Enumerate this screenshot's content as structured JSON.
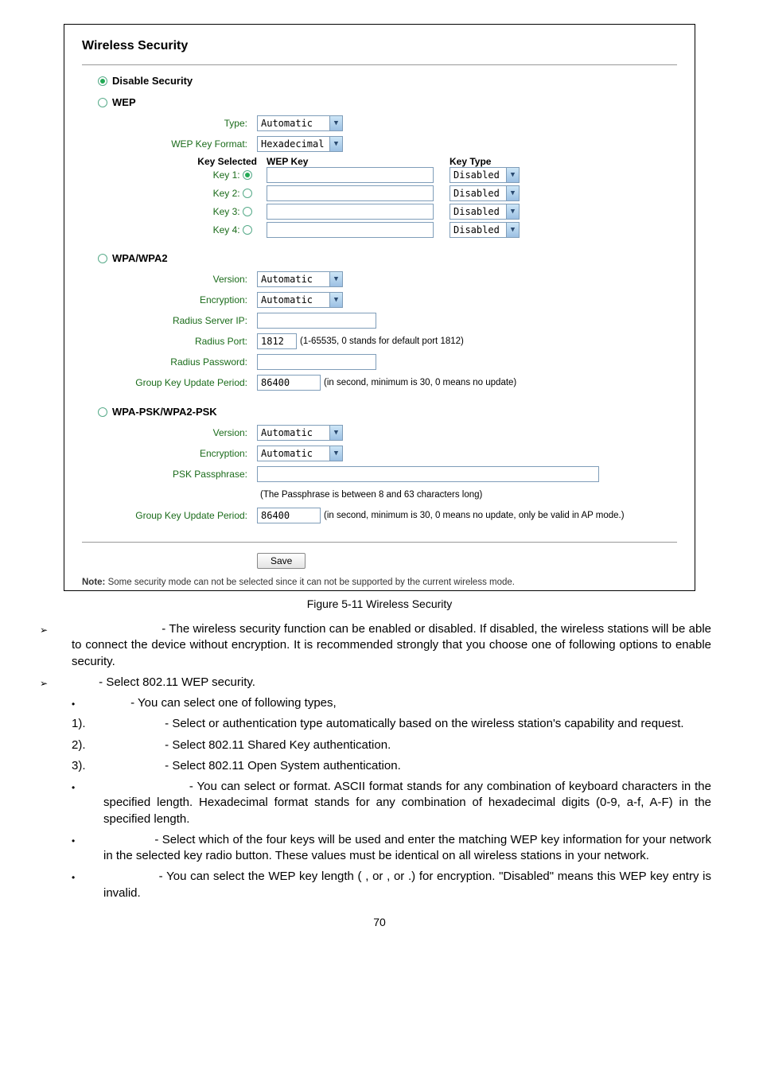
{
  "figure": {
    "title": "Wireless Security",
    "disable_security_label": "Disable Security",
    "wep": {
      "heading": "WEP",
      "type_label": "Type:",
      "type_value": "Automatic",
      "format_label": "WEP Key Format:",
      "format_value": "Hexadecimal",
      "key_selected_header": "Key Selected",
      "wep_key_header": "WEP Key",
      "key_type_header": "Key Type",
      "rows": [
        {
          "label": "Key 1:",
          "selected": true,
          "type": "Disabled"
        },
        {
          "label": "Key 2:",
          "selected": false,
          "type": "Disabled"
        },
        {
          "label": "Key 3:",
          "selected": false,
          "type": "Disabled"
        },
        {
          "label": "Key 4:",
          "selected": false,
          "type": "Disabled"
        }
      ]
    },
    "wpa": {
      "heading": "WPA/WPA2",
      "version_label": "Version:",
      "version_value": "Automatic",
      "encryption_label": "Encryption:",
      "encryption_value": "Automatic",
      "radius_ip_label": "Radius Server IP:",
      "radius_port_label": "Radius Port:",
      "radius_port_value": "1812",
      "radius_port_hint": "(1-65535, 0 stands for default port 1812)",
      "radius_pw_label": "Radius Password:",
      "gkup_label": "Group Key Update Period:",
      "gkup_value": "86400",
      "gkup_hint": "(in second, minimum is 30, 0 means no update)"
    },
    "psk": {
      "heading": "WPA-PSK/WPA2-PSK",
      "version_label": "Version:",
      "version_value": "Automatic",
      "encryption_label": "Encryption:",
      "encryption_value": "Automatic",
      "passphrase_label": "PSK Passphrase:",
      "passphrase_hint": "(The Passphrase is between 8 and 63 characters long)",
      "gkup_label": "Group Key Update Period:",
      "gkup_value": "86400",
      "gkup_hint": "(in second, minimum is 30, 0 means no update, only be valid in AP mode.)"
    },
    "save_label": "Save",
    "note_prefix": "Note:",
    "note_text": "  Some security mode can not be selected since it can not be supported by the current wireless mode."
  },
  "caption": "Figure 5-11 Wireless Security",
  "body": {
    "item1": " - The wireless security function can be enabled or disabled. If disabled, the wireless stations will be able to connect the device without encryption. It is recommended strongly that you choose one of following options to enable security.",
    "item2": " - Select 802.11 WEP security.",
    "item2a": " - You can select one of following types,",
    "num1": " - Select                          or                              authentication type automatically based on the wireless station's capability and request.",
    "num1_lbl": "1).",
    "num2": " - Select 802.11 Shared Key authentication.",
    "num2_lbl": "2).",
    "num3": " - Select 802.11 Open System authentication.",
    "num3_lbl": "3).",
    "item2b": " - You can select              or                       format. ASCII format stands for any combination of keyboard characters in the specified length. Hexadecimal format stands for any combination of hexadecimal digits (0-9, a-f, A-F) in the specified length.",
    "item2c": " - Select which of the four keys will be used and enter the matching WEP key information for your network in the selected key radio button. These values must be identical on all wireless stations in your network.",
    "item2d": " - You can select the WEP key length (         , or           , or          .) for encryption. \"Disabled\" means this WEP key entry is invalid."
  },
  "pagenum": "70"
}
